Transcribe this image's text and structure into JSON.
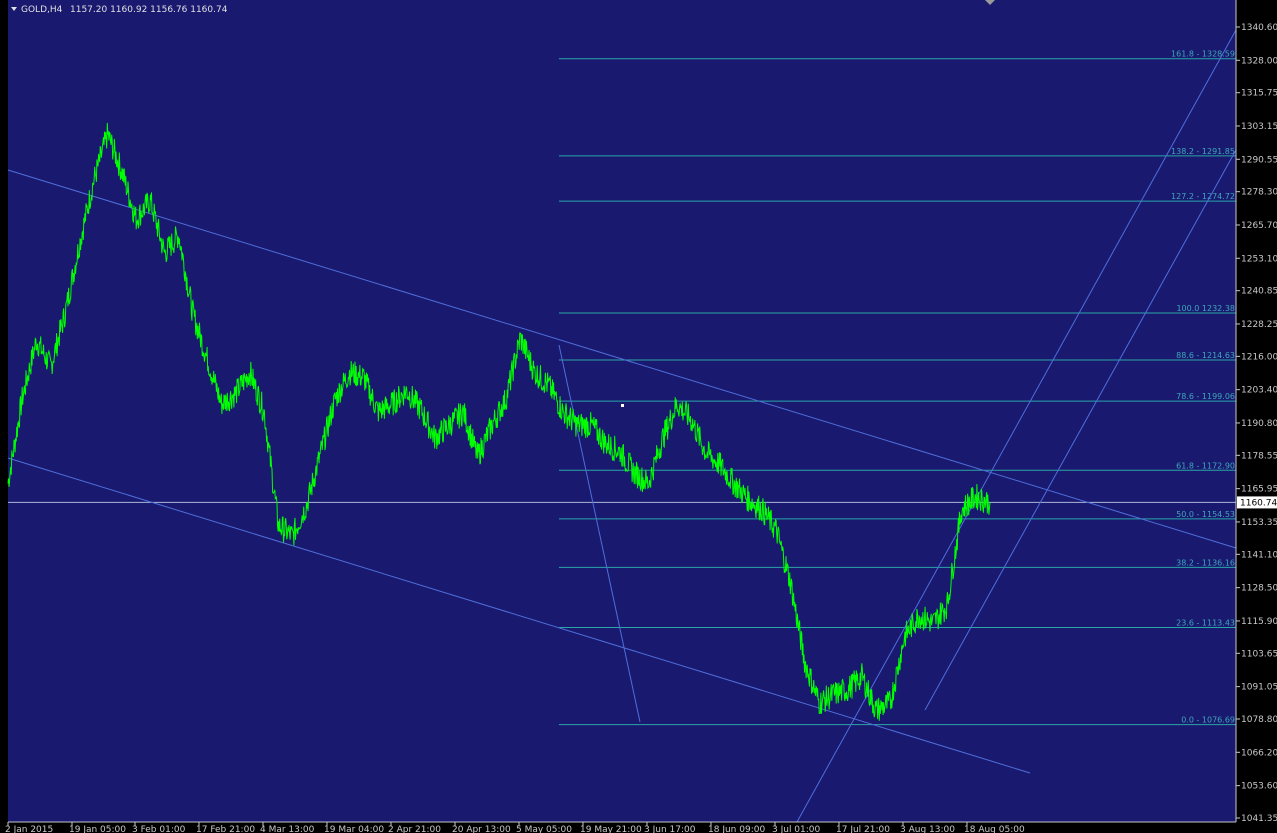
{
  "header": {
    "symbol": "GOLD,H4",
    "ohlc": "1157.20 1160.92 1156.76 1160.74"
  },
  "colors": {
    "plot_bg": "#191970",
    "price": "#00ff00",
    "trendline": "#4f6fd9",
    "fib": "#2aa6a6",
    "axis_text": "#c8c8c8",
    "current_price_bg": "#ffffff"
  },
  "chart_data": {
    "type": "line",
    "instrument": "GOLD",
    "timeframe": "H4",
    "title": "GOLD,H4",
    "current_price": "1160.74",
    "ylim": [
      1041.35,
      1346
    ],
    "y_ticks": [
      "1340.60",
      "1328.00",
      "1315.75",
      "1303.15",
      "1290.55",
      "1278.30",
      "1265.70",
      "1253.10",
      "1240.85",
      "1228.25",
      "1216.00",
      "1203.40",
      "1190.80",
      "1178.55",
      "1165.95",
      "1153.35",
      "1141.10",
      "1128.50",
      "1115.90",
      "1103.65",
      "1091.05",
      "1078.80",
      "1066.20",
      "1053.60",
      "1041.35"
    ],
    "x_ticks": [
      "2 Jan 2015",
      "19 Jan 05:00",
      "3 Feb 01:00",
      "17 Feb 21:00",
      "4 Mar 13:00",
      "19 Mar 04:00",
      "2 Apr 21:00",
      "20 Apr 13:00",
      "5 May 05:00",
      "19 May 21:00",
      "3 Jun 17:00",
      "18 Jun 09:00",
      "3 Jul 01:00",
      "17 Jul 21:00",
      "3 Aug 13:00",
      "18 Aug 05:00"
    ],
    "fib_levels": [
      {
        "label": "161.8 - 1328.59",
        "value": 1328.59
      },
      {
        "label": "138.2 - 1291.85",
        "value": 1291.85
      },
      {
        "label": "127.2 - 1274.72",
        "value": 1274.72
      },
      {
        "label": "100.0  1232.38",
        "value": 1232.38
      },
      {
        "label": "88.6 - 1214.63",
        "value": 1214.63
      },
      {
        "label": "78.6 - 1199.06",
        "value": 1199.06
      },
      {
        "label": "61.8 - 1172.90",
        "value": 1172.9
      },
      {
        "label": "50.0 - 1154.53",
        "value": 1154.53
      },
      {
        "label": "38.2 - 1136.16",
        "value": 1136.16
      },
      {
        "label": "23.6 - 1113.43",
        "value": 1113.43
      },
      {
        "label": "0.0 - 1076.69",
        "value": 1076.69
      }
    ],
    "series": [
      {
        "values": [
          1168,
          1200,
          1222,
          1212,
          1232,
          1258,
          1282,
          1300,
          1286,
          1268,
          1275,
          1255,
          1262,
          1232,
          1215,
          1198,
          1202,
          1210,
          1195,
          1152,
          1148,
          1160,
          1180,
          1200,
          1210,
          1208,
          1195,
          1198,
          1203,
          1196,
          1185,
          1190,
          1195,
          1178,
          1190,
          1200,
          1223,
          1210,
          1205,
          1195,
          1190,
          1190,
          1183,
          1180,
          1172,
          1168,
          1185,
          1198,
          1192,
          1180,
          1175,
          1168,
          1162,
          1158,
          1150,
          1130,
          1100,
          1085,
          1088,
          1090,
          1095,
          1082,
          1085,
          1110,
          1118,
          1115,
          1122,
          1158,
          1163,
          1160.74
        ],
        "x_end_fraction": 0.793
      }
    ]
  }
}
